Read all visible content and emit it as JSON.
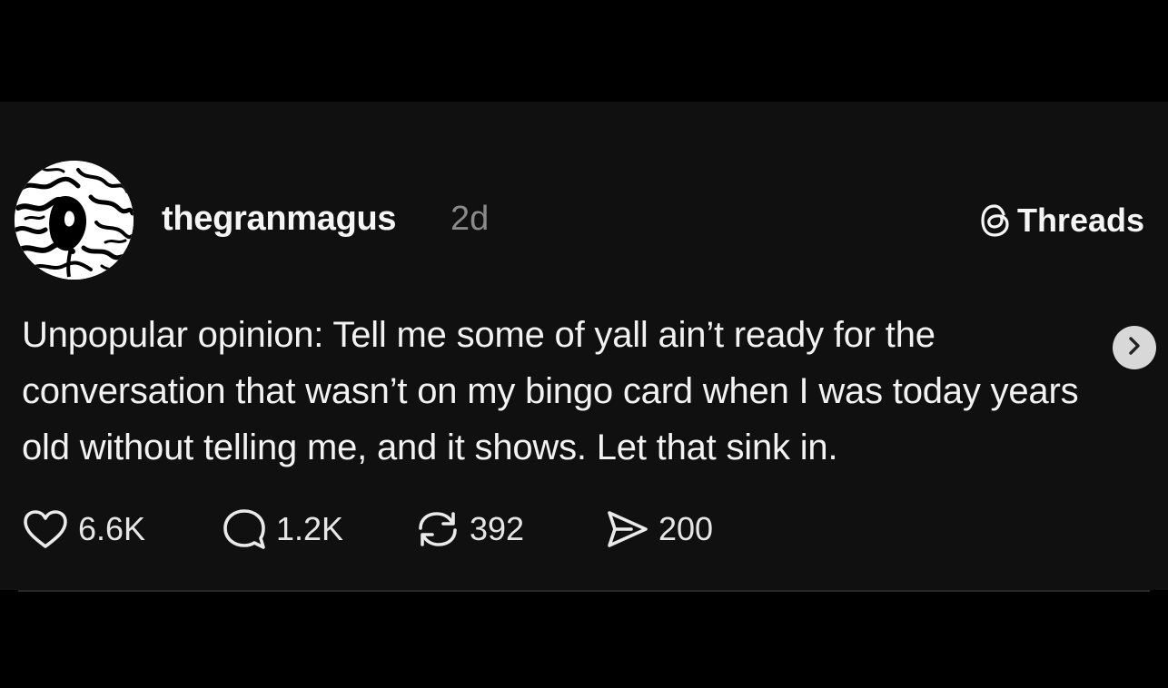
{
  "post": {
    "username": "thegranmagus",
    "timestamp": "2d",
    "brand": "Threads",
    "text": "Unpopular opinion: Tell me some of yall ain’t ready for the conversation that wasn’t on my bingo card when I was today years old without telling me, and it shows. Let that sink in."
  },
  "actions": {
    "likes": "6.6K",
    "replies": "1.2K",
    "reposts": "392",
    "shares": "200"
  },
  "icons": {
    "avatar": "avatar-image",
    "brand": "threads-logo-icon",
    "next": "chevron-right-icon",
    "like": "heart-icon",
    "reply": "speech-bubble-icon",
    "repost": "repost-icon",
    "share": "send-icon"
  },
  "colors": {
    "background": "#000000",
    "card": "#101010",
    "text": "#f2f2f2",
    "muted": "#8a8a8a",
    "next_button": "#d8d8d8"
  }
}
